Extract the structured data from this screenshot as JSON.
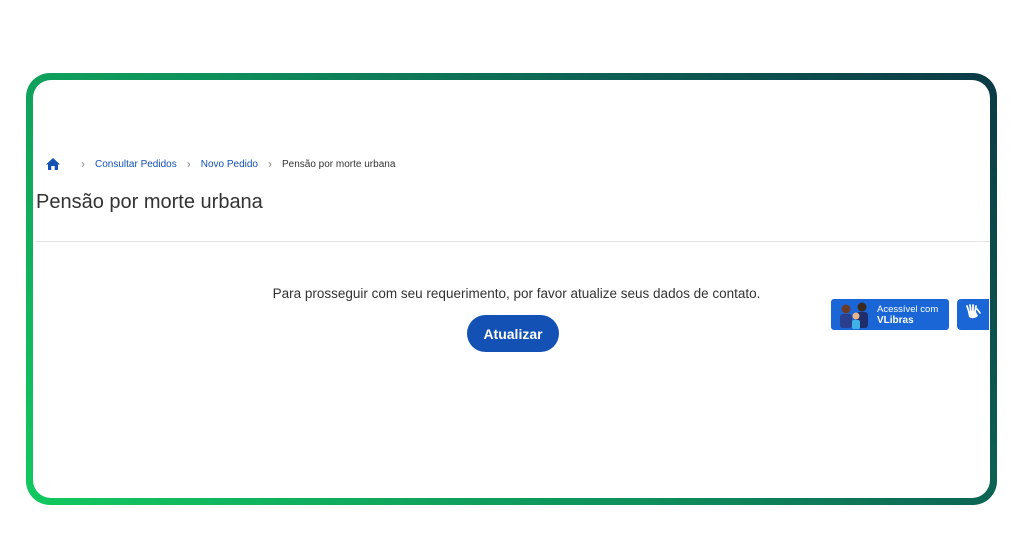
{
  "breadcrumb": {
    "home_icon": "home-icon",
    "items": [
      "Consultar Pedidos",
      "Novo Pedido"
    ],
    "current": "Pensão por morte urbana"
  },
  "page": {
    "title": "Pensão por morte urbana",
    "message": "Para prosseguir com seu requerimento, por favor atualize seus dados de contato.",
    "button_label": "Atualizar"
  },
  "vlibras": {
    "line1": "Acessível com",
    "line2": "VLibras",
    "icon": "sign-language-hands-icon"
  },
  "colors": {
    "primary": "#1351b4",
    "vlibras_blue": "#1a66d6",
    "frame_start": "#12c95f",
    "frame_end": "#0b3a45"
  }
}
